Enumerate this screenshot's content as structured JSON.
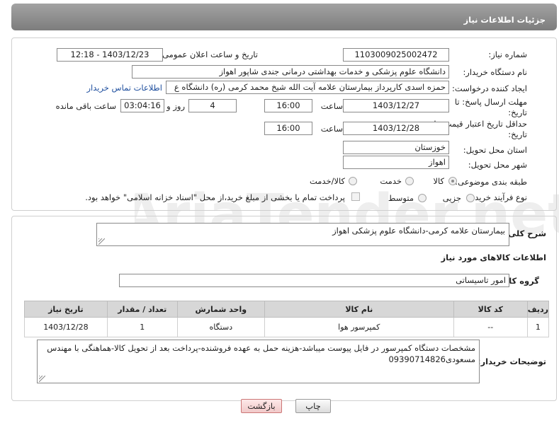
{
  "header": {
    "title": "جزئیات اطلاعات نیاز"
  },
  "form": {
    "need_number_label": "شماره نیاز:",
    "need_number": "1103009025002472",
    "announce_label": "تاریخ و ساعت اعلان عمومی:",
    "announce_value": "1403/12/23 - 12:18",
    "buyer_org_label": "نام دستگاه خریدار:",
    "buyer_org": "دانشگاه علوم پزشکی و خدمات بهداشتی درمانی جندی شاپور اهواز",
    "creator_label": "ایجاد کننده درخواست:",
    "creator": "حمزه اسدی کارپرداز بیمارستان علامه آیت الله شیخ محمد کرمی (ره) دانشگاه ع",
    "contact_link": "اطلاعات تماس خریدار",
    "deadline_label_1": "مهلت ارسال پاسخ: تا",
    "deadline_label_2": "تاریخ:",
    "deadline_date": "1403/12/27",
    "time_label": "ساعت",
    "deadline_time": "16:00",
    "days_value": "4",
    "days_label": "روز و",
    "remaining_time": "03:04:16",
    "remaining_label": "ساعت باقی مانده",
    "validity_label_1": "حداقل تاریخ اعتبار قیمت: تا",
    "validity_label_2": "تاریخ:",
    "validity_date": "1403/12/28",
    "validity_time_label": "ساعت",
    "validity_time": "16:00",
    "province_label": "استان محل تحویل:",
    "province": "خوزستان",
    "city_label": "شهر محل تحویل:",
    "city": "اهواز",
    "category_label": "طبقه بندی موضوعی:",
    "category_options": [
      "کالا",
      "خدمت",
      "کالا/خدمت"
    ],
    "category_selected": "کالا",
    "process_label": "نوع فرآیند خرید :",
    "process_options": [
      "جزیی",
      "متوسط"
    ],
    "payment_note": "پرداخت تمام یا بخشی از مبلغ خرید،از محل \"اسناد خزانه اسلامی\" خواهد بود."
  },
  "details": {
    "description_label": "شرح کلی نیاز:",
    "description": "بیمارستان علامه کرمی-دانشگاه علوم پزشکی اهواز",
    "goods_info_title": "اطلاعات کالاهای مورد نیاز",
    "group_label": "گروه کالا:",
    "group_value": "امور تاسیساتی",
    "table": {
      "headers": [
        "ردیف",
        "کد کالا",
        "نام کالا",
        "واحد شمارش",
        "تعداد / مقدار",
        "تاریخ نیاز"
      ],
      "rows": [
        [
          "1",
          "--",
          "کمپرسور هوا",
          "دستگاه",
          "1",
          "1403/12/28"
        ]
      ]
    },
    "buyer_notes_label": "توضیحات خریدار:",
    "buyer_notes": "مشخصات دستگاه کمپرسور در فایل پیوست میباشد-هزینه حمل به عهده فروشنده-پرداخت بعد از تحویل کالا-هماهنگی با مهندس مسعودی09390714826"
  },
  "buttons": {
    "print": "چاپ",
    "back": "بازگشت"
  },
  "watermark_text": "AriaTender.net"
}
